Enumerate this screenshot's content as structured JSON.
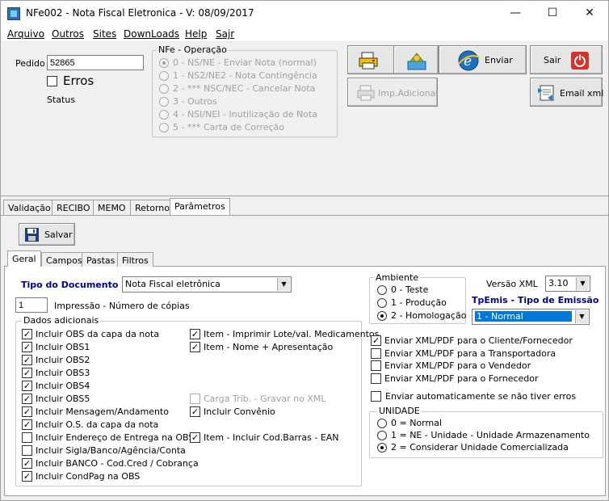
{
  "window": {
    "title": "NFe002 - Nota Fiscal Eletronica - V: 08/09/2017",
    "minimize": "—",
    "maximize": "☐",
    "close": "✕"
  },
  "menu": [
    "Arquivo",
    "Outros",
    "Sites",
    "DownLoads",
    "Help",
    "Sajr"
  ],
  "pedido": {
    "label": "Pedido",
    "value": "52865"
  },
  "erros": {
    "label": "Erros",
    "checked": false
  },
  "status_label": "Status",
  "operacao": {
    "title": "NFe - Operação",
    "options": [
      {
        "label": "0 - NS/NE - Enviar Nota (normal)",
        "selected": true
      },
      {
        "label": "1 - NS2/NE2 - Nota Contingência",
        "selected": false
      },
      {
        "label": "2 - *** NSC/NEC - Cancelar Nota",
        "selected": false
      },
      {
        "label": "3 - Outros",
        "selected": false
      },
      {
        "label": "4 - NSI/NEI - Inutilização de Nota",
        "selected": false
      },
      {
        "label": "5 - *** Carta de Correção",
        "selected": false
      }
    ]
  },
  "toolbar": {
    "enviar": "Enviar",
    "sair": "Sair",
    "imp_adicional": "Imp.Adicional",
    "email_xml": "Email xml"
  },
  "tabs": [
    "Validação",
    "RECIBO",
    "MEMO",
    "Retorno",
    "Parâmetros"
  ],
  "salvar": "Salvar",
  "inner_tabs": [
    "Geral",
    "Campos",
    "Pastas",
    "Filtros"
  ],
  "tipo_documento": {
    "label": "Tipo do Documento :",
    "value": "Nota Fiscal eletrônica"
  },
  "copias": {
    "value": "1",
    "label": "Impressão - Número de cópias"
  },
  "dados": {
    "title": "Dados adicionais",
    "left": [
      {
        "label": "Incluir OBS da capa da nota",
        "checked": true
      },
      {
        "label": "Incluir OBS1",
        "checked": true
      },
      {
        "label": "Incluir OBS2",
        "checked": true
      },
      {
        "label": "Incluir OBS3",
        "checked": true
      },
      {
        "label": "Incluir OBS4",
        "checked": true
      },
      {
        "label": "Incluir OBS5",
        "checked": true
      },
      {
        "label": "Incluir Mensagem/Andamento",
        "checked": true
      },
      {
        "label": "Incluir O.S. da capa da nota",
        "checked": true
      },
      {
        "label": "Incluir Endereço de Entrega na OBS",
        "checked": false
      },
      {
        "label": "Incluir Sigla/Banco/Agência/Conta",
        "checked": false
      },
      {
        "label": "Incluir BANCO - Cod.Cred / Cobrança",
        "checked": true
      },
      {
        "label": "Incluir CondPag na OBS",
        "checked": true
      }
    ],
    "right_top": [
      {
        "label": "Item - Imprimir Lote/val. Medicamentos",
        "checked": true
      },
      {
        "label": "Item - Nome + Apresentação",
        "checked": true
      }
    ],
    "carga": {
      "label": "Carga Trib. - Gravar no XML",
      "checked": false
    },
    "convenio": {
      "label": "Incluir Convênio",
      "checked": true
    },
    "barras": {
      "label": "Item - Incluir Cod.Barras - EAN",
      "checked": true
    }
  },
  "ambiente": {
    "title": "Ambiente",
    "options": [
      {
        "label": "0 - Teste",
        "selected": false
      },
      {
        "label": "1 - Produção",
        "selected": false
      },
      {
        "label": "2 - Homologação",
        "selected": true
      }
    ]
  },
  "versao_xml": {
    "label": "Versão XML",
    "value": "3.10"
  },
  "tpemis": {
    "label": "TpEmis - Tipo de Emissão",
    "value": "1 - Normal"
  },
  "enviar_opts": [
    {
      "label": "Enviar XML/PDF para o Cliente/Fornecedor",
      "checked": true
    },
    {
      "label": "Enviar XML/PDF para a Transportadora",
      "checked": false
    },
    {
      "label": "Enviar XML/PDF para o Vendedor",
      "checked": false
    },
    {
      "label": "Enviar XML/PDF para o Fornecedor",
      "checked": false
    }
  ],
  "auto_envio": {
    "label": "Enviar automaticamente se não tiver erros",
    "checked": false
  },
  "unidade": {
    "title": "UNIDADE",
    "options": [
      {
        "label": "0 = Normal",
        "selected": false
      },
      {
        "label": "1 = NE - Unidade - Unidade Armazenamento",
        "selected": false
      },
      {
        "label": "2 = Considerar Unidade Comercializada",
        "selected": true
      }
    ]
  },
  "colors": {
    "tpemis_label": "#00008b",
    "tipo_label": "#00008b",
    "selected_bg": "#0078d7",
    "sair_red": "#d9302a"
  }
}
